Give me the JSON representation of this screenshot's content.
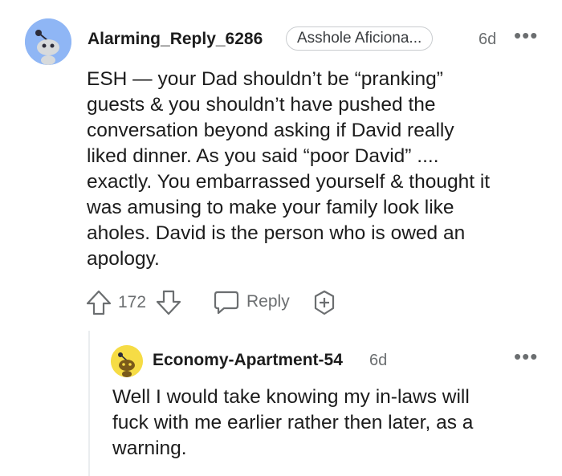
{
  "comment": {
    "username": "Alarming_Reply_6286",
    "flair": "Asshole Aficiona...",
    "age": "6d",
    "body": "ESH — your Dad shouldn’t be “pranking”\nguests & you shouldn’t have pushed the\nconversation beyond asking if David really\nliked dinner. As you said “poor David” ....\nexactly. You embarrassed yourself & thought it\nwas amusing to make your family look like\naholes. David is the person who is owed an\napology.",
    "score": "172",
    "reply_label": "Reply",
    "avatar_color": "#8fb6f5"
  },
  "reply": {
    "username": "Economy-Apartment-54",
    "age": "6d",
    "body": "Well I would take knowing my in-laws will\nfuck with me earlier rather then later, as a\nwarning.",
    "avatar_color": "#f6dc45"
  },
  "icons": {
    "more": "more-options-icon",
    "upvote": "upvote-arrow-icon",
    "downvote": "downvote-arrow-icon",
    "reply": "speech-bubble-icon",
    "award": "award-plus-icon"
  }
}
